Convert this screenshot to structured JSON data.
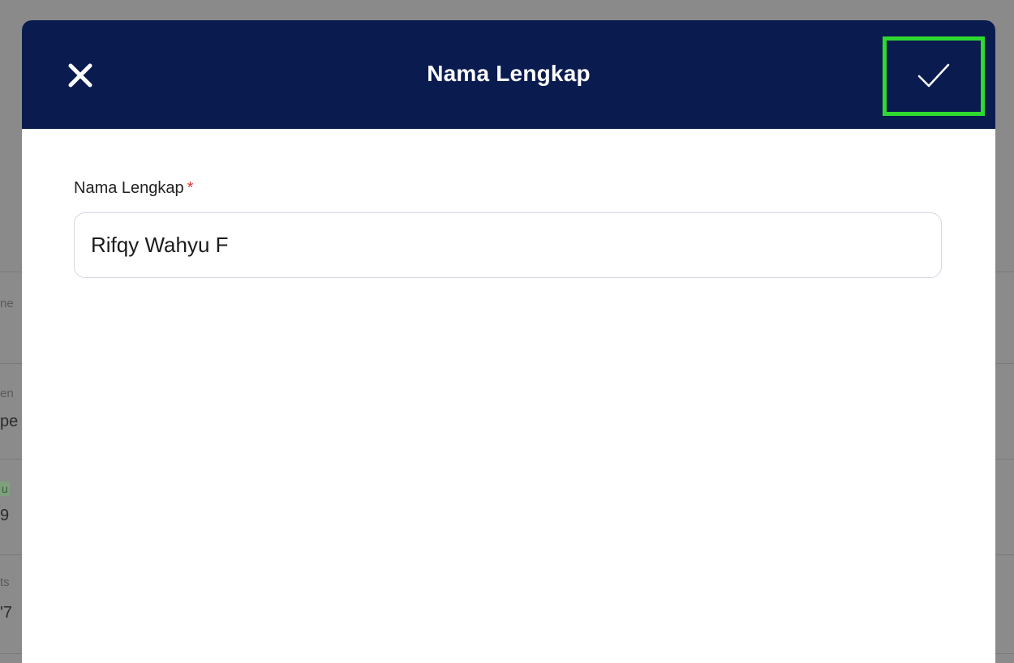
{
  "background": {
    "fragments": [
      "ne",
      "en",
      "pe",
      "u",
      "9",
      "ts",
      "'7"
    ]
  },
  "modal": {
    "title": "Nama Lengkap",
    "close_icon": "close-icon",
    "confirm_icon": "check-icon",
    "field": {
      "label": "Nama Lengkap",
      "required_mark": "*",
      "value": "Rifqy Wahyu F"
    }
  },
  "colors": {
    "header_bg": "#0a1b4f",
    "confirm_highlight": "#2fd92f",
    "required": "#e53935"
  }
}
